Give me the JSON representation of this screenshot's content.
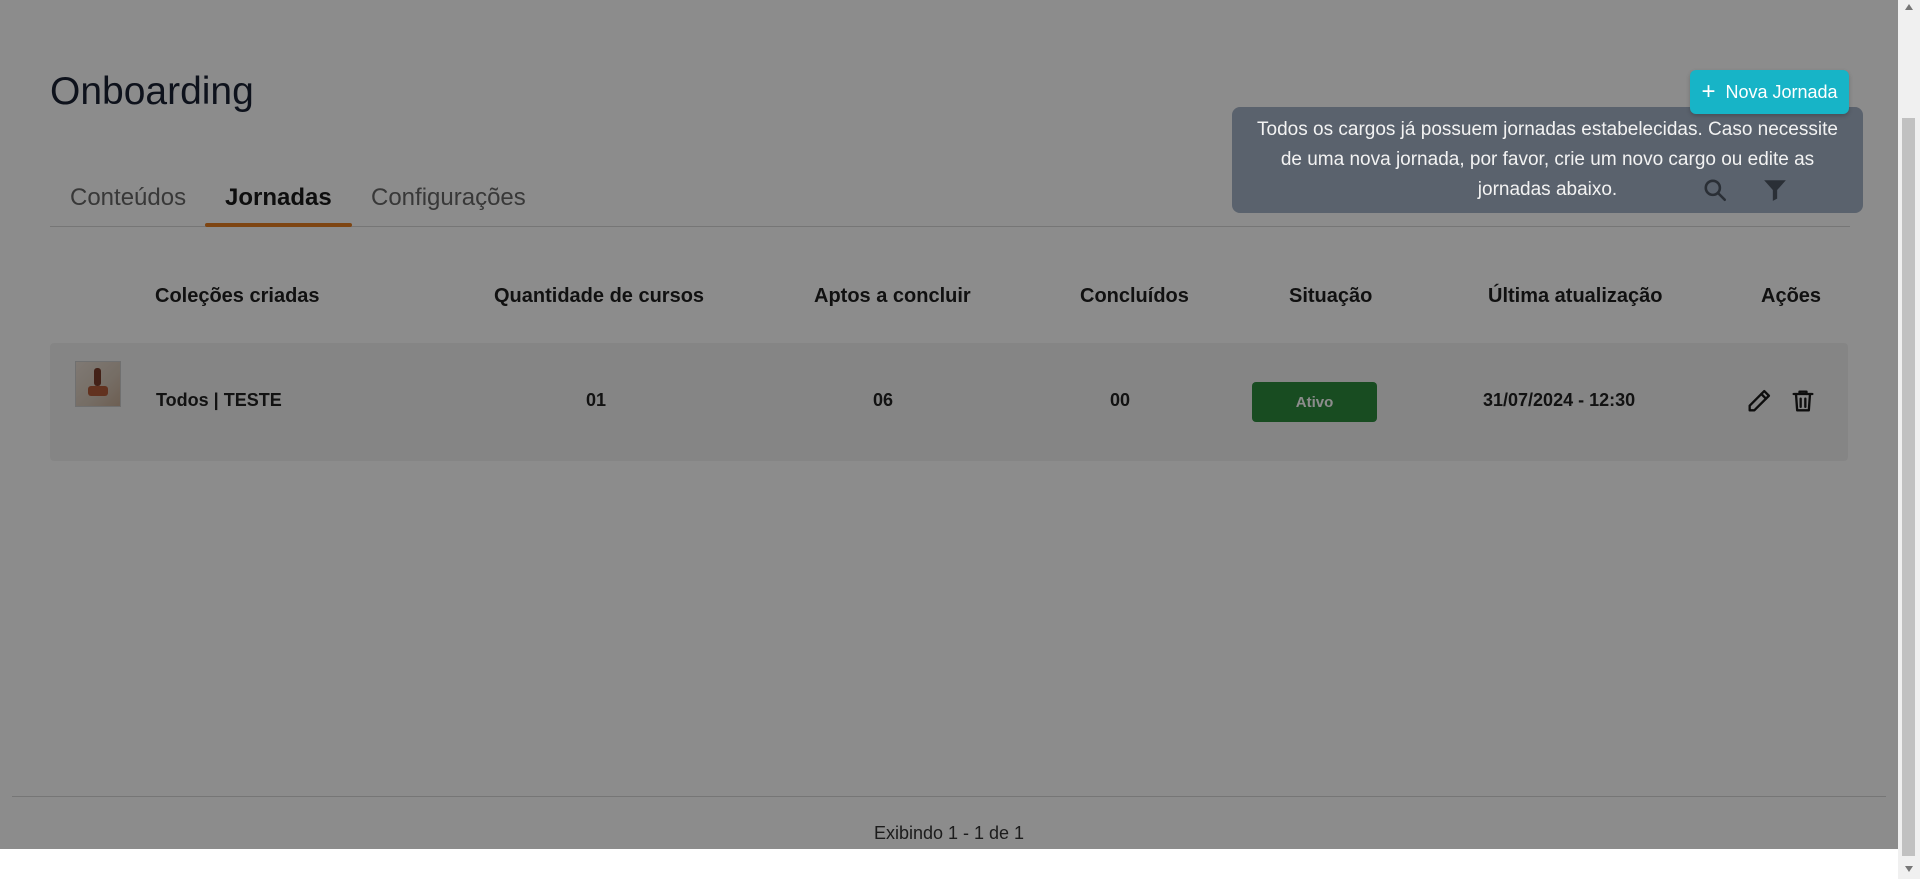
{
  "page": {
    "title": "Onboarding"
  },
  "tabs": [
    {
      "label": "Conteúdos",
      "active": false
    },
    {
      "label": "Jornadas",
      "active": true
    },
    {
      "label": "Configurações",
      "active": false
    }
  ],
  "toolbar": {
    "new_button_label": "Nova Jornada"
  },
  "tooltip": {
    "text": "Todos os cargos já possuem jornadas estabelecidas. Caso necessite de uma nova jornada, por favor, crie um novo cargo ou edite as jornadas abaixo."
  },
  "table": {
    "columns": [
      "Coleções criadas",
      "Quantidade de cursos",
      "Aptos a concluir",
      "Concluídos",
      "Situação",
      "Última atualização",
      "Ações"
    ],
    "rows": [
      {
        "name": "Todos | TESTE",
        "courses": "01",
        "eligible": "06",
        "completed": "00",
        "status": "Ativo",
        "updated": "31/07/2024 - 12:30"
      }
    ]
  },
  "pagination": {
    "summary": "Exibindo 1 - 1 de 1"
  },
  "colors": {
    "accent": "#17b4c7",
    "tab_indicator": "#e67e22",
    "status_active": "#2d8a3d",
    "tooltip_bg": "#5a626d"
  },
  "icons": {
    "new_button": "plus-icon",
    "tooltip_actions": [
      "search-icon",
      "filter-icon"
    ],
    "row_actions": [
      "edit-icon",
      "trash-icon"
    ]
  }
}
